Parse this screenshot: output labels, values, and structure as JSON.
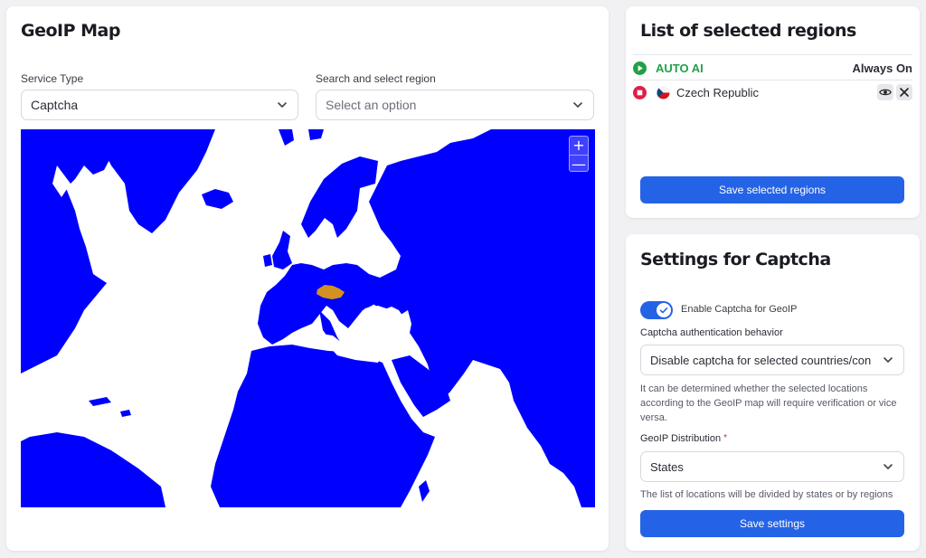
{
  "map_card": {
    "title": "GeoIP Map",
    "service_type_label": "Service Type",
    "service_type_value": "Captcha",
    "region_label": "Search and select region",
    "region_placeholder": "Select an option",
    "zoom_in": "+",
    "zoom_out": "—",
    "ocean_color": "#ffffff",
    "land_color": "#0000ff",
    "selected_country_color": "#d29121"
  },
  "list_card": {
    "title": "List of selected regions",
    "rows": [
      {
        "icon": "play-icon",
        "name": "AUTO AI",
        "status": "Always On",
        "status_color": "#22a049"
      },
      {
        "icon": "stop-icon",
        "name": "Czech Republic",
        "flag": "czech-flag-icon",
        "status_color": "#e11d48"
      }
    ],
    "save_button": "Save selected regions"
  },
  "settings_card": {
    "title": "Settings for Captcha",
    "enable_label": "Enable Captcha for GeoIP",
    "enable_checked": true,
    "behavior_label": "Captcha authentication behavior",
    "behavior_value": "Disable captcha for selected countries/continents",
    "behavior_help": "It can be determined whether the selected locations according to the GeoIP map will require verification or vice versa.",
    "distribution_label": "GeoIP Distribution",
    "required_mark": "*",
    "distribution_value": "States",
    "distribution_help": "The list of locations will be divided by states or by regions",
    "save_button": "Save settings"
  },
  "accent_color": "#2563e6"
}
